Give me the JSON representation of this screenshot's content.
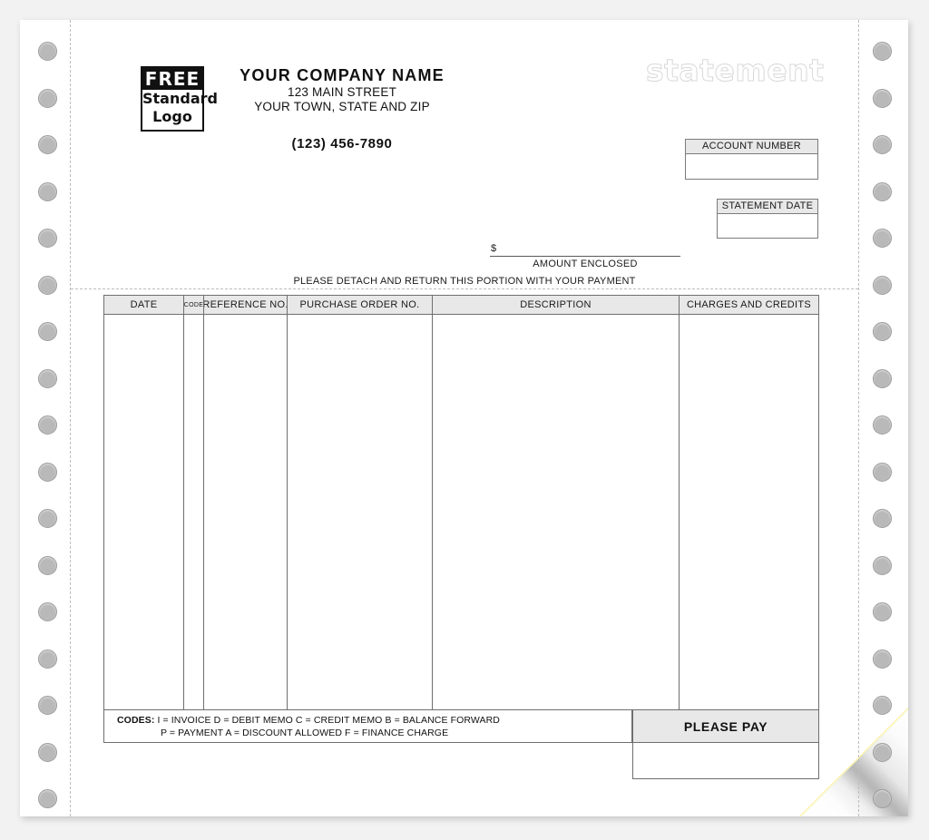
{
  "document": {
    "watermark": "statement",
    "detach_note": "PLEASE DETACH AND RETURN THIS PORTION WITH YOUR PAYMENT"
  },
  "logo": {
    "line1": "FREE",
    "line2": "Standard",
    "line3": "Logo"
  },
  "company": {
    "name": "YOUR COMPANY NAME",
    "street": "123 MAIN STREET",
    "city_state_zip": "YOUR TOWN, STATE AND ZIP",
    "phone": "(123) 456-7890"
  },
  "fields": {
    "account_number_label": "ACCOUNT NUMBER",
    "account_number_value": "",
    "statement_date_label": "STATEMENT DATE",
    "statement_date_value": "",
    "dollar_sign": "$",
    "amount_enclosed_label": "AMOUNT ENCLOSED",
    "amount_enclosed_value": ""
  },
  "table": {
    "columns": [
      {
        "label": "DATE",
        "key": "date"
      },
      {
        "label": "CODE",
        "key": "code"
      },
      {
        "label": "REFERENCE NO.",
        "key": "reference_no"
      },
      {
        "label": "PURCHASE ORDER NO.",
        "key": "purchase_order_no"
      },
      {
        "label": "DESCRIPTION",
        "key": "description"
      },
      {
        "label": "CHARGES AND CREDITS",
        "key": "charges_and_credits"
      }
    ],
    "rows": []
  },
  "codes": {
    "label": "CODES:",
    "line1": "I = INVOICE   D = DEBIT MEMO   C = CREDIT MEMO   B = BALANCE FORWARD",
    "line2": "P = PAYMENT   A = DISCOUNT ALLOWED   F = FINANCE CHARGE"
  },
  "please_pay": {
    "label": "PLEASE PAY",
    "value": ""
  },
  "colors": {
    "paper": "#ffffff",
    "carbon_copy": "#faf3a8",
    "rule": "#6f6f6f",
    "header_fill": "#e8e8e8",
    "perforation": "#bdbdbd",
    "sprocket_hole": "#b9b9b9",
    "watermark_outline": "#d8d8d8",
    "page_background": "#f2f2f2"
  }
}
